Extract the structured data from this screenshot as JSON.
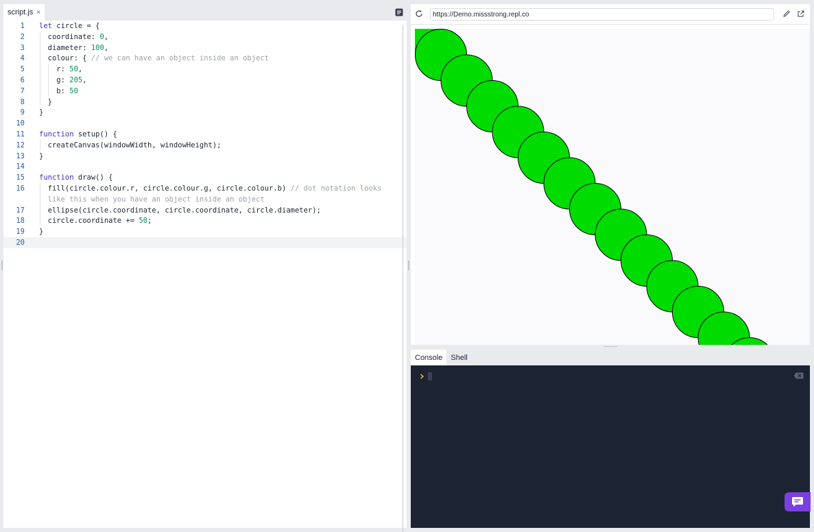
{
  "editor": {
    "tab_label": "script.js",
    "tab_close": "×",
    "lines": [
      {
        "n": "1",
        "html": "<span class=\"kw\">let</span> circle = {"
      },
      {
        "n": "2",
        "html": "  coordinate: <span class=\"num\">0</span>,"
      },
      {
        "n": "3",
        "html": "  diameter: <span class=\"num\">100</span>,"
      },
      {
        "n": "4",
        "html": "  colour: { <span class=\"cmt\">// we can have an object inside an object</span>"
      },
      {
        "n": "5",
        "html": "    r: <span class=\"num\">50</span>,"
      },
      {
        "n": "6",
        "html": "    g: <span class=\"num\">205</span>,"
      },
      {
        "n": "7",
        "html": "    b: <span class=\"num\">50</span>"
      },
      {
        "n": "8",
        "html": "  }"
      },
      {
        "n": "9",
        "html": "}"
      },
      {
        "n": "10",
        "html": ""
      },
      {
        "n": "11",
        "html": "<span class=\"kw\">function</span> setup() {"
      },
      {
        "n": "12",
        "html": "  createCanvas(windowWidth, windowHeight);"
      },
      {
        "n": "13",
        "html": "}"
      },
      {
        "n": "14",
        "html": ""
      },
      {
        "n": "15",
        "html": "<span class=\"kw\">function</span> draw() {"
      },
      {
        "n": "16",
        "html": "  fill(circle.colour.r, circle.colour.g, circle.colour.b) <span class=\"cmt\">// dot notation looks</span>"
      },
      {
        "n": "",
        "html": "  <span class=\"cmt\">like this when you have an object inside an object</span>"
      },
      {
        "n": "17",
        "html": "  ellipse(circle.coordinate, circle.coordinate, circle.diameter);"
      },
      {
        "n": "18",
        "html": "  circle.coordinate += <span class=\"num\">50</span>;"
      },
      {
        "n": "19",
        "html": "}"
      },
      {
        "n": "20",
        "html": ""
      }
    ],
    "active_line": "20",
    "colors": {
      "keyword": "#3c2fbf",
      "number": "#0a8a5e",
      "comment": "#9aa0a8"
    }
  },
  "webview": {
    "url": "https://Demo.missstrong.repl.co",
    "icons": [
      "reload-icon",
      "edit-icon",
      "external-link-icon"
    ]
  },
  "canvas": {
    "fill_color": "#00dc00",
    "stroke_color": "#000000",
    "circle_count": 14,
    "diameter": 75,
    "step": 37.5
  },
  "console": {
    "tabs": [
      {
        "label": "Console",
        "active": true
      },
      {
        "label": "Shell",
        "active": false
      }
    ],
    "prompt_icon": "chevron-right-icon",
    "clear_icon": "clear-console-icon"
  },
  "chat_button": {
    "icon": "chat-icon",
    "color": "#7a3fe0"
  }
}
